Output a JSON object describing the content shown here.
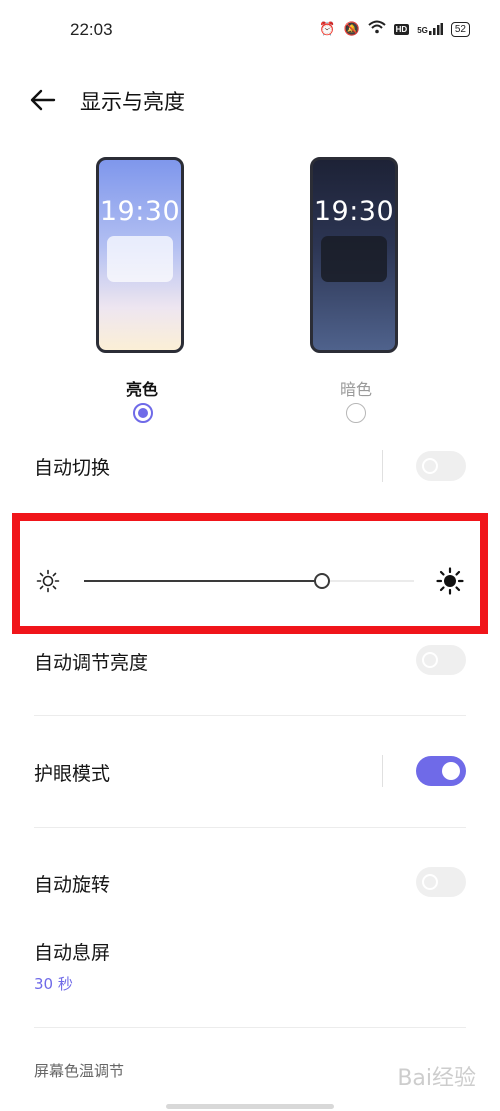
{
  "status_bar": {
    "time": "22:03",
    "icons": [
      "alarm-icon",
      "mute-icon",
      "wifi-icon",
      "hd-icon",
      "5g-signal-icon",
      "battery-icon"
    ],
    "hd_label": "HD",
    "network": "5G",
    "battery": "52"
  },
  "header": {
    "back_icon": "arrow-left-icon",
    "title": "显示与亮度"
  },
  "themes": [
    {
      "label": "亮色",
      "preview_time": "19:30",
      "selected": true
    },
    {
      "label": "暗色",
      "preview_time": "19:30",
      "selected": false
    }
  ],
  "rows": {
    "auto_switch": {
      "label": "自动切换",
      "on": false
    },
    "brightness": {
      "level": 0.72,
      "icon_min": "sun-low-icon",
      "icon_max": "sun-high-icon"
    },
    "auto_brightness": {
      "label": "自动调节亮度",
      "on": false
    },
    "eye_comfort": {
      "label": "护眼模式",
      "on": true
    },
    "auto_rotate": {
      "label": "自动旋转",
      "on": false
    },
    "screen_timeout": {
      "label": "自动息屏",
      "value": "30 秒"
    },
    "color_temp_header": "屏幕色温调节"
  },
  "watermark": "Bai经验",
  "colors": {
    "accent": "#6f6ae8",
    "highlight": "#f0151a",
    "toggle_off": "#efefef"
  }
}
